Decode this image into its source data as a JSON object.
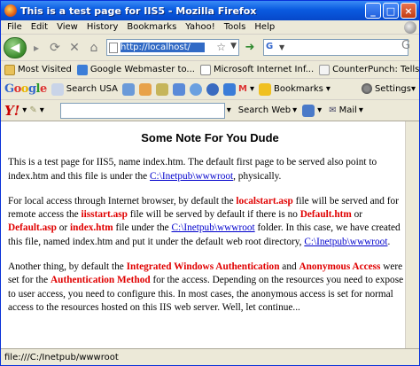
{
  "window": {
    "title": "This is a test page for IIS5 - Mozilla Firefox"
  },
  "menu": [
    "File",
    "Edit",
    "View",
    "History",
    "Bookmarks",
    "Yahoo!",
    "Tools",
    "Help"
  ],
  "nav": {
    "url": "http://localhost/",
    "search_placeholder": ""
  },
  "bookmarks": [
    {
      "label": "Most Visited",
      "color": "#2a5db0"
    },
    {
      "label": "Google Webmaster to...",
      "color": "#3b7dd8"
    },
    {
      "label": "Microsoft Internet Inf...",
      "color": "#888888"
    },
    {
      "label": "CounterPunch: Tells t...",
      "color": "#d33"
    }
  ],
  "google_toolbar": {
    "search_label": "Search USA",
    "bookmarks_label": "Bookmarks",
    "settings_label": "Settings"
  },
  "yahoo_toolbar": {
    "search_web_label": "Search Web",
    "mail_label": "Mail"
  },
  "content": {
    "heading": "Some Note For You Dude",
    "p1_a": "This is a test page for IIS5, name index.htm. The default first page to be served also point to index.htm and this file is under the ",
    "p1_link": "C:\\Inetpub\\wwwroot",
    "p1_b": ", physically.",
    "p2_a": "For local access through Internet browser, by default the ",
    "p2_r1": "localstart.asp",
    "p2_b": " file will be served and for remote access the ",
    "p2_r2": "iisstart.asp",
    "p2_c": " file will be served by default if there is no ",
    "p2_r3": "Default.htm",
    "p2_d": " or ",
    "p2_r4": "Default.asp",
    "p2_e": " or ",
    "p2_r5": "index.htm",
    "p2_f": " file under the ",
    "p2_link1": "C:\\Inetpub\\wwwroot",
    "p2_g": " folder. In this case, we have created this file, named index.htm and put it under the default web root directory, ",
    "p2_link2": "C:\\Inetpub\\wwwroot",
    "p2_h": ".",
    "p3_a": "Another thing, by default the ",
    "p3_r1": "Integrated Windows Authentication",
    "p3_b": " and ",
    "p3_r2": "Anonymous Access",
    "p3_c": " were set for the ",
    "p3_r3": "Authentication Method",
    "p3_d": " for the access. Depending on the resources you need to expose to user access, you need to configure this. In most cases, the anonymous access is set for normal access to the resources hosted on this IIS web server. Well, let continue..."
  },
  "status": "file:///C:/Inetpub/wwwroot"
}
